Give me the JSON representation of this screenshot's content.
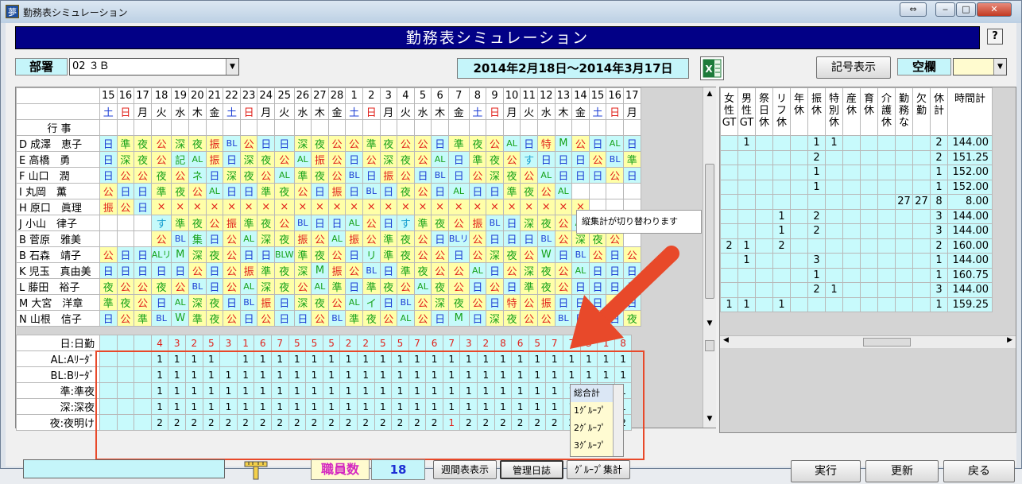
{
  "window": {
    "title": "勤務表シミュレーション",
    "icon": "夢"
  },
  "banner": {
    "title": "勤務表シミュレーション"
  },
  "help": "?",
  "dept": {
    "label": "部署",
    "value": "02 ３Ｂ"
  },
  "period": "2014年2月18日～2014年3月17日",
  "buttons": {
    "symbols": "記号表示",
    "blank": "空欄",
    "run": "実行",
    "update": "更新",
    "back": "戻る",
    "weekly": "週間表表示",
    "log": "管理日誌",
    "group": "ｸﾞﾙｰﾌﾟ集計"
  },
  "days": [
    "15",
    "16",
    "17",
    "18",
    "19",
    "20",
    "21",
    "22",
    "23",
    "24",
    "25",
    "26",
    "27",
    "28",
    "1",
    "2",
    "3",
    "4",
    "5",
    "6",
    "7",
    "8",
    "9",
    "10",
    "11",
    "12",
    "13",
    "14",
    "15",
    "16",
    "17"
  ],
  "weekdays": [
    "土",
    "日",
    "月",
    "火",
    "水",
    "木",
    "金",
    "土",
    "日",
    "月",
    "火",
    "水",
    "木",
    "金",
    "土",
    "日",
    "月",
    "火",
    "水",
    "木",
    "金",
    "土",
    "日",
    "月",
    "火",
    "水",
    "木",
    "金",
    "土",
    "日",
    "月"
  ],
  "events_label": "行 事",
  "staff": [
    {
      "name": "D 成澤　恵子",
      "shifts": [
        "日",
        "準",
        "夜",
        "公",
        "深",
        "夜",
        "振",
        "BL",
        "公",
        "日",
        "日",
        "深",
        "夜",
        "公",
        "公",
        "準",
        "夜",
        "公",
        "公",
        "日",
        "準",
        "夜",
        "公",
        "AL",
        "日",
        "特",
        "M",
        "公",
        "日",
        "AL",
        "日"
      ]
    },
    {
      "name": "E 高橋　勇",
      "shifts": [
        "日",
        "深",
        "夜",
        "公",
        "記",
        "AL",
        "振",
        "日",
        "深",
        "夜",
        "公",
        "AL",
        "振",
        "公",
        "日",
        "公",
        "深",
        "夜",
        "公",
        "AL",
        "日",
        "準",
        "夜",
        "公",
        "す",
        "日",
        "日",
        "日",
        "公",
        "BL",
        "準"
      ]
    },
    {
      "name": "F 山口　潤",
      "shifts": [
        "日",
        "公",
        "公",
        "夜",
        "公",
        "ネ",
        "日",
        "深",
        "夜",
        "公",
        "AL",
        "準",
        "夜",
        "公",
        "BL",
        "日",
        "振",
        "公",
        "日",
        "BL",
        "日",
        "公",
        "深",
        "夜",
        "公",
        "AL",
        "日",
        "日",
        "日",
        "公",
        "日"
      ]
    },
    {
      "name": "I 丸岡　薫",
      "shifts": [
        "公",
        "日",
        "日",
        "準",
        "夜",
        "公",
        "AL",
        "日",
        "日",
        "準",
        "夜",
        "公",
        "日",
        "振",
        "日",
        "BL",
        "日",
        "夜",
        "公",
        "日",
        "AL",
        "日",
        "日",
        "準",
        "夜",
        "公",
        "AL",
        "",
        "",
        "",
        ""
      ]
    },
    {
      "name": "H 原口　眞理",
      "shifts": [
        "振",
        "公",
        "日",
        "×",
        "×",
        "×",
        "×",
        "×",
        "×",
        "×",
        "×",
        "×",
        "×",
        "×",
        "×",
        "×",
        "×",
        "×",
        "×",
        "×",
        "×",
        "×",
        "×",
        "×",
        "×",
        "×",
        "×",
        "×",
        "",
        "",
        ""
      ]
    },
    {
      "name": "J 小山　律子",
      "shifts": [
        "",
        "",
        "",
        "す",
        "準",
        "夜",
        "公",
        "振",
        "準",
        "夜",
        "公",
        "BL",
        "日",
        "日",
        "AL",
        "公",
        "日",
        "す",
        "準",
        "夜",
        "公",
        "振",
        "BL",
        "日",
        "深",
        "夜",
        "公",
        "AL",
        "リ",
        "公",
        "公"
      ]
    },
    {
      "name": "B 菅原　雅美",
      "shifts": [
        "",
        "",
        "",
        "公",
        "BL",
        "集",
        "日",
        "公",
        "AL",
        "深",
        "夜",
        "振",
        "公",
        "AL",
        "振",
        "公",
        "準",
        "夜",
        "公",
        "日",
        "BLリ",
        "公",
        "日",
        "日",
        "日",
        "BL",
        "公",
        "深",
        "夜",
        "公",
        ""
      ]
    },
    {
      "name": "B 石森　靖子",
      "shifts": [
        "公",
        "日",
        "日",
        "ALリ",
        "M",
        "深",
        "夜",
        "公",
        "日",
        "日",
        "BLW",
        "準",
        "夜",
        "公",
        "日",
        "リ",
        "準",
        "夜",
        "公",
        "公",
        "日",
        "公",
        "深",
        "夜",
        "公",
        "W",
        "日",
        "BL",
        "公",
        "日",
        "公"
      ]
    },
    {
      "name": "K 児玉　真由美",
      "shifts": [
        "日",
        "日",
        "日",
        "日",
        "日",
        "公",
        "日",
        "公",
        "振",
        "準",
        "夜",
        "深",
        "M",
        "振",
        "公",
        "BL",
        "日",
        "準",
        "夜",
        "公",
        "公",
        "AL",
        "日",
        "公",
        "深",
        "夜",
        "公",
        "AL",
        "日",
        "日",
        "日"
      ]
    },
    {
      "name": "L 藤田　裕子",
      "shifts": [
        "夜",
        "公",
        "公",
        "夜",
        "公",
        "BL",
        "日",
        "公",
        "AL",
        "深",
        "夜",
        "公",
        "AL",
        "準",
        "日",
        "準",
        "夜",
        "公",
        "AL",
        "夜",
        "公",
        "日",
        "公",
        "日",
        "準",
        "夜",
        "公",
        "日",
        "日",
        "日",
        "日"
      ]
    },
    {
      "name": "M 大宮　洋章",
      "shifts": [
        "準",
        "夜",
        "公",
        "日",
        "AL",
        "深",
        "夜",
        "日",
        "BL",
        "振",
        "日",
        "深",
        "夜",
        "公",
        "AL",
        "イ",
        "日",
        "BL",
        "公",
        "深",
        "夜",
        "公",
        "日",
        "特",
        "公",
        "振",
        "日",
        "日",
        "日",
        "公",
        "日"
      ]
    },
    {
      "name": "N 山根　信子",
      "shifts": [
        "日",
        "公",
        "準",
        "BL",
        "W",
        "準",
        "夜",
        "公",
        "日",
        "公",
        "日",
        "日",
        "公",
        "BL",
        "準",
        "夜",
        "公",
        "AL",
        "公",
        "日",
        "M",
        "日",
        "深",
        "夜",
        "公",
        "公",
        "BL",
        "日",
        "公",
        "日",
        "夜"
      ]
    }
  ],
  "summary": [
    {
      "label": "日:日勤",
      "values": [
        "",
        "",
        "",
        "4",
        "3",
        "2",
        "5",
        "3",
        "1",
        "6",
        "7",
        "5",
        "5",
        "5",
        "2",
        "2",
        "5",
        "5",
        "7",
        "6",
        "7",
        "3",
        "2",
        "8",
        "6",
        "5",
        "7",
        "7",
        "3",
        "1",
        "8"
      ]
    },
    {
      "label": "AL:Aﾘｰﾀﾞ",
      "values": [
        "",
        "",
        "",
        "1",
        "1",
        "1",
        "1",
        "",
        "1",
        "1",
        "1",
        "1",
        "1",
        "1",
        "1",
        "1",
        "1",
        "1",
        "1",
        "1",
        "1",
        "1",
        "1",
        "1",
        "1",
        "1",
        "1",
        "1",
        "1",
        "1",
        "1"
      ]
    },
    {
      "label": "BL:Bﾘｰﾀﾞ",
      "values": [
        "",
        "",
        "",
        "1",
        "1",
        "1",
        "1",
        "1",
        "1",
        "1",
        "1",
        "1",
        "1",
        "1",
        "1",
        "1",
        "1",
        "1",
        "1",
        "1",
        "1",
        "1",
        "1",
        "1",
        "1",
        "1",
        "1",
        "1",
        "1",
        "1",
        "1"
      ]
    },
    {
      "label": "準:準夜",
      "values": [
        "",
        "",
        "",
        "1",
        "1",
        "1",
        "1",
        "1",
        "1",
        "1",
        "1",
        "1",
        "1",
        "1",
        "1",
        "1",
        "1",
        "1",
        "1",
        "1",
        "1",
        "1",
        "1",
        "1",
        "1",
        "1",
        "1",
        "1",
        "1",
        "1",
        "1"
      ]
    },
    {
      "label": "深:深夜",
      "values": [
        "",
        "",
        "",
        "1",
        "1",
        "1",
        "1",
        "1",
        "1",
        "1",
        "1",
        "1",
        "1",
        "1",
        "1",
        "1",
        "1",
        "1",
        "1",
        "1",
        "1",
        "1",
        "1",
        "1",
        "1",
        "1",
        "1",
        "1",
        "1",
        "1",
        "1"
      ]
    },
    {
      "label": "夜:夜明け",
      "values": [
        "",
        "",
        "",
        "2",
        "2",
        "2",
        "2",
        "2",
        "2",
        "2",
        "2",
        "2",
        "2",
        "2",
        "2",
        "2",
        "2",
        "2",
        "2",
        "2",
        "1",
        "2",
        "2",
        "2",
        "2",
        "2",
        "2",
        "2",
        "2",
        "2",
        "2"
      ]
    }
  ],
  "right_headers": [
    "女性GT",
    "男性GT",
    "祭日休",
    "リフ休",
    "年休",
    "振休",
    "特別休",
    "産休",
    "育休",
    "介護休",
    "勤務な",
    "欠勤",
    "休計",
    "時間計"
  ],
  "right_rows": [
    [
      "",
      "1",
      "",
      "",
      "",
      "1",
      "1",
      "",
      "",
      "",
      "",
      "",
      "2",
      "144.00"
    ],
    [
      "",
      "",
      "",
      "",
      "",
      "2",
      "",
      "",
      "",
      "",
      "",
      "",
      "2",
      "151.25"
    ],
    [
      "",
      "",
      "",
      "",
      "",
      "1",
      "",
      "",
      "",
      "",
      "",
      "",
      "1",
      "152.00"
    ],
    [
      "",
      "",
      "",
      "",
      "",
      "1",
      "",
      "",
      "",
      "",
      "",
      "",
      "1",
      "152.00"
    ],
    [
      "",
      "",
      "",
      "",
      "",
      "",
      "",
      "",
      "",
      "",
      "27",
      "27",
      "8",
      "8.00"
    ],
    [
      "",
      "",
      "",
      "1",
      "",
      "2",
      "",
      "",
      "",
      "",
      "",
      "",
      "3",
      "144.00"
    ],
    [
      "",
      "",
      "",
      "1",
      "",
      "2",
      "",
      "",
      "",
      "",
      "",
      "",
      "3",
      "144.00"
    ],
    [
      "2",
      "1",
      "",
      "2",
      "",
      "",
      "",
      "",
      "",
      "",
      "",
      "",
      "2",
      "160.00"
    ],
    [
      "",
      "1",
      "",
      "",
      "",
      "3",
      "",
      "",
      "",
      "",
      "",
      "",
      "1",
      "144.00"
    ],
    [
      "",
      "",
      "",
      "",
      "",
      "1",
      "",
      "",
      "",
      "",
      "",
      "",
      "1",
      "160.75"
    ],
    [
      "",
      "",
      "",
      "",
      "",
      "2",
      "1",
      "",
      "",
      "",
      "",
      "",
      "3",
      "144.00"
    ],
    [
      "1",
      "1",
      "",
      "1",
      "",
      "",
      "",
      "",
      "",
      "",
      "",
      "",
      "1",
      "159.25"
    ]
  ],
  "tooltip": "縦集計が切り替わります",
  "group_list": [
    "総合計",
    "1ｸﾞﾙｰﾌﾟ",
    "2ｸﾞﾙｰﾌﾟ",
    "3ｸﾞﾙｰﾌﾟ"
  ],
  "staff_count_label": "職員数",
  "staff_count": "18",
  "colors": {
    "banner": "#020086",
    "cyan": "#c5f5fa",
    "yellow": "#ffffa8",
    "red_annotation": "#e8492a"
  }
}
